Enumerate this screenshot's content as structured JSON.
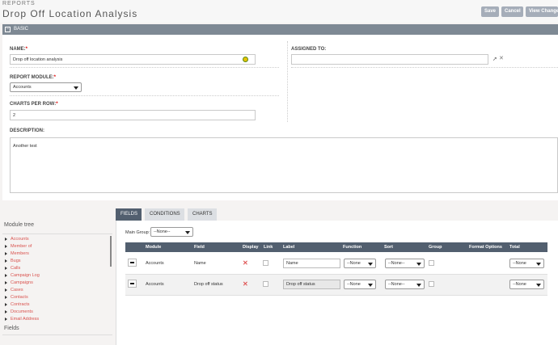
{
  "header": {
    "breadcrumb": "REPORTS",
    "title": "Drop Off Location Analysis",
    "buttons": {
      "save": "Save",
      "cancel": "Cancel",
      "view": "View Change"
    }
  },
  "panel": {
    "toggle": "−",
    "title": "BASIC"
  },
  "form": {
    "name_label": "NAME:",
    "name_value": "Drop off location analysis",
    "required_mark": "*",
    "module_label": "REPORT MODULE:",
    "module_value": "Accounts",
    "charts_label": "CHARTS PER ROW:",
    "charts_value": "2",
    "assigned_label": "ASSIGNED TO:",
    "assigned_value": "",
    "description_label": "DESCRIPTION:",
    "description_value": "Another test"
  },
  "module_tree": {
    "title": "Module tree",
    "items": [
      "Accounts",
      "Member of",
      "Members",
      "Bugs",
      "Calls",
      "Campaign Log",
      "Campaigns",
      "Cases",
      "Contacts",
      "Contracts",
      "Documents",
      "Email Address"
    ],
    "fields_title": "Fields"
  },
  "tabs": [
    "FIELDS",
    "CONDITIONS",
    "CHARTS"
  ],
  "main_group": {
    "label": "Main Group:",
    "value": "--None--"
  },
  "table": {
    "columns": [
      "Module",
      "Field",
      "Display",
      "Link",
      "Label",
      "Function",
      "Sort",
      "Group",
      "Format Options",
      "Total"
    ],
    "rows": [
      {
        "module": "Accounts",
        "field": "Name",
        "label": "Name",
        "function": "--None",
        "sort": "--None--",
        "total": "--None"
      },
      {
        "module": "Accounts",
        "field": "Drop off status",
        "label": "Drop off status",
        "function": "--None",
        "sort": "--None--",
        "total": "--None"
      }
    ]
  }
}
